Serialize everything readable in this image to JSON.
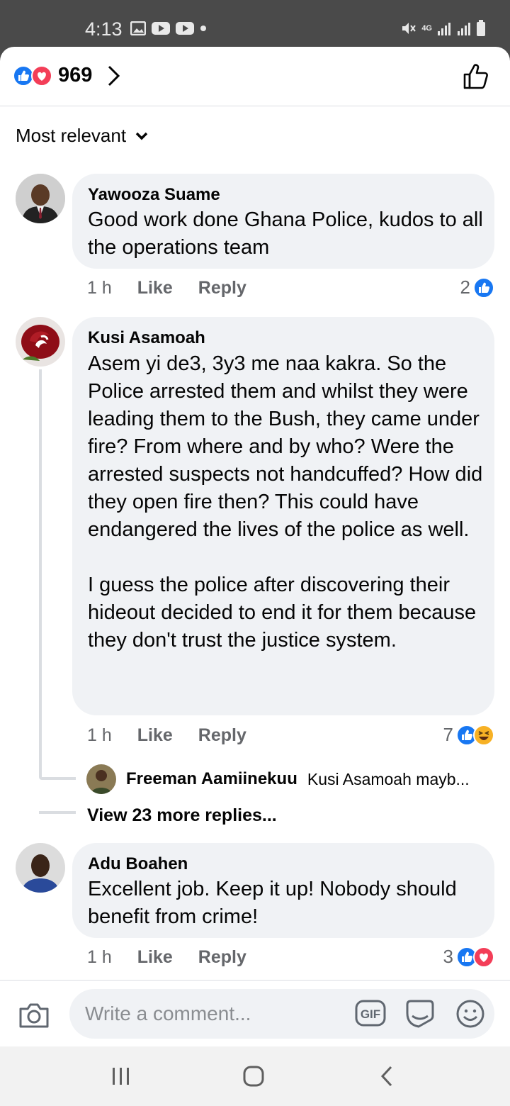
{
  "status_bar": {
    "time": "4:13",
    "network": "4G"
  },
  "reaction_bar": {
    "count": "969"
  },
  "sort": {
    "label": "Most relevant"
  },
  "comments": [
    {
      "author": "Yawooza Suame",
      "text": "Good work done Ghana Police, kudos to all the operations team",
      "time": "1 h",
      "like": "Like",
      "reply": "Reply",
      "reaction_count": "2"
    },
    {
      "author": "Kusi Asamoah",
      "text": "Asem yi de3, 3y3 me naa kakra. So the Police arrested them and whilst they were leading them to the Bush, they came under fire? From where and by who? Were the arrested suspects not handcuffed? How did they open fire then? This could have endangered the lives of the police as well.\n\nI guess the police after discovering their hideout decided to end it for them because they don't trust the justice system.",
      "time": "1 h",
      "like": "Like",
      "reply": "Reply",
      "reaction_count": "7",
      "reply_preview": {
        "author": "Freeman Aamiinekuu",
        "snippet": "Kusi Asamoah mayb..."
      },
      "more_replies": "View 23 more replies..."
    },
    {
      "author": "Adu Boahen",
      "text": "Excellent job. Keep it up! Nobody should benefit from crime!",
      "time": "1 h",
      "like": "Like",
      "reply": "Reply",
      "reaction_count": "3"
    }
  ],
  "composer": {
    "placeholder": "Write a comment...",
    "gif_label": "GIF"
  },
  "colors": {
    "like_blue": "#1877f2",
    "love_red": "#f33e58",
    "haha_yellow": "#f7b125",
    "bubble": "#f0f2f5",
    "meta_gray": "#65676b"
  },
  "icons": [
    "image-icon",
    "youtube-icon",
    "mute-icon",
    "signal-icon",
    "battery-icon",
    "like-reaction-icon",
    "love-reaction-icon",
    "haha-reaction-icon",
    "chevron-right-icon",
    "thumbs-up-icon",
    "chevron-down-icon",
    "camera-icon",
    "gif-icon",
    "sticker-icon",
    "emoji-icon",
    "recents-icon",
    "home-icon",
    "back-icon"
  ]
}
